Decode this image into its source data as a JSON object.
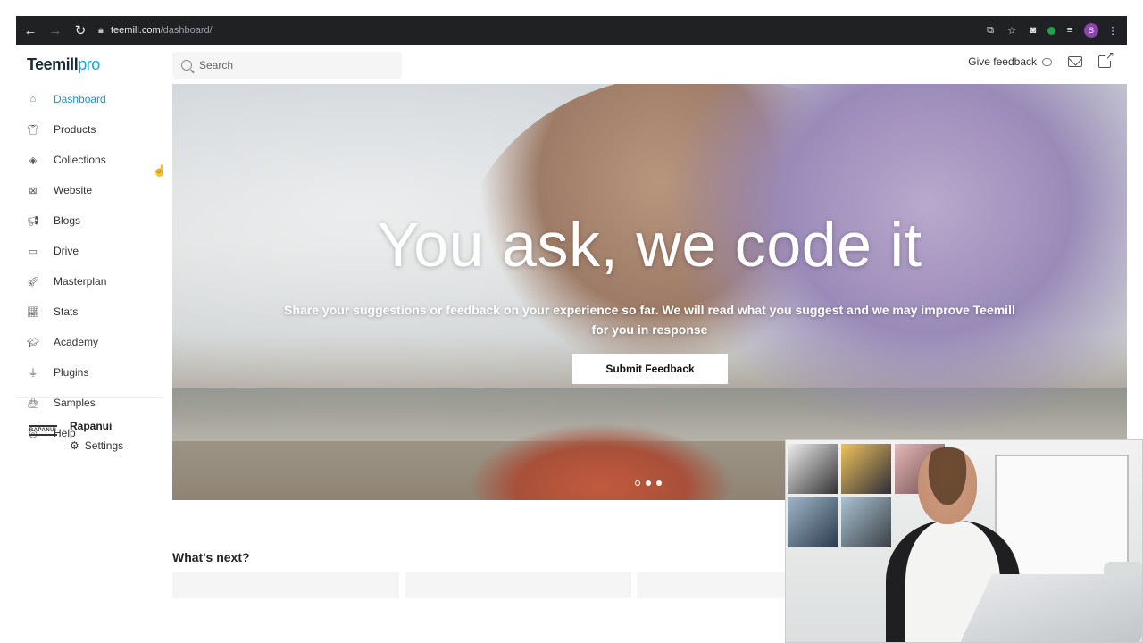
{
  "browser": {
    "url_domain": "teemill.com",
    "url_path": "/dashboard/",
    "profile_initial": "S"
  },
  "app": {
    "logo_main": "Teemill",
    "logo_suffix": "pro",
    "search_placeholder": "Search",
    "give_feedback": "Give feedback"
  },
  "sidebar": {
    "items": [
      {
        "label": "Dashboard",
        "icon": "home-icon",
        "active": true
      },
      {
        "label": "Products",
        "icon": "tshirt-icon"
      },
      {
        "label": "Collections",
        "icon": "layers-icon"
      },
      {
        "label": "Website",
        "icon": "website-icon"
      },
      {
        "label": "Blogs",
        "icon": "megaphone-icon"
      },
      {
        "label": "Drive",
        "icon": "drive-icon"
      },
      {
        "label": "Masterplan",
        "icon": "rocket-icon"
      },
      {
        "label": "Stats",
        "icon": "chart-icon"
      },
      {
        "label": "Academy",
        "icon": "graduation-cap-icon"
      },
      {
        "label": "Plugins",
        "icon": "plug-icon"
      },
      {
        "label": "Samples",
        "icon": "bag-icon"
      },
      {
        "label": "Help",
        "icon": "lifebuoy-icon"
      }
    ],
    "store_name": "Rapanui",
    "store_logo_text": "RAPANUI",
    "settings_label": "Settings"
  },
  "hero": {
    "title": "You ask, we code it",
    "subtitle": "Share your suggestions or feedback on your experience so far. We will read what you suggest and we may improve Teemill for you in response",
    "button": "Submit Feedback",
    "slides": 3,
    "active_slide": 1
  },
  "next": {
    "title": "What's next?"
  },
  "colors": {
    "accent": "#1a94c6",
    "chrome_bg": "#202124"
  }
}
